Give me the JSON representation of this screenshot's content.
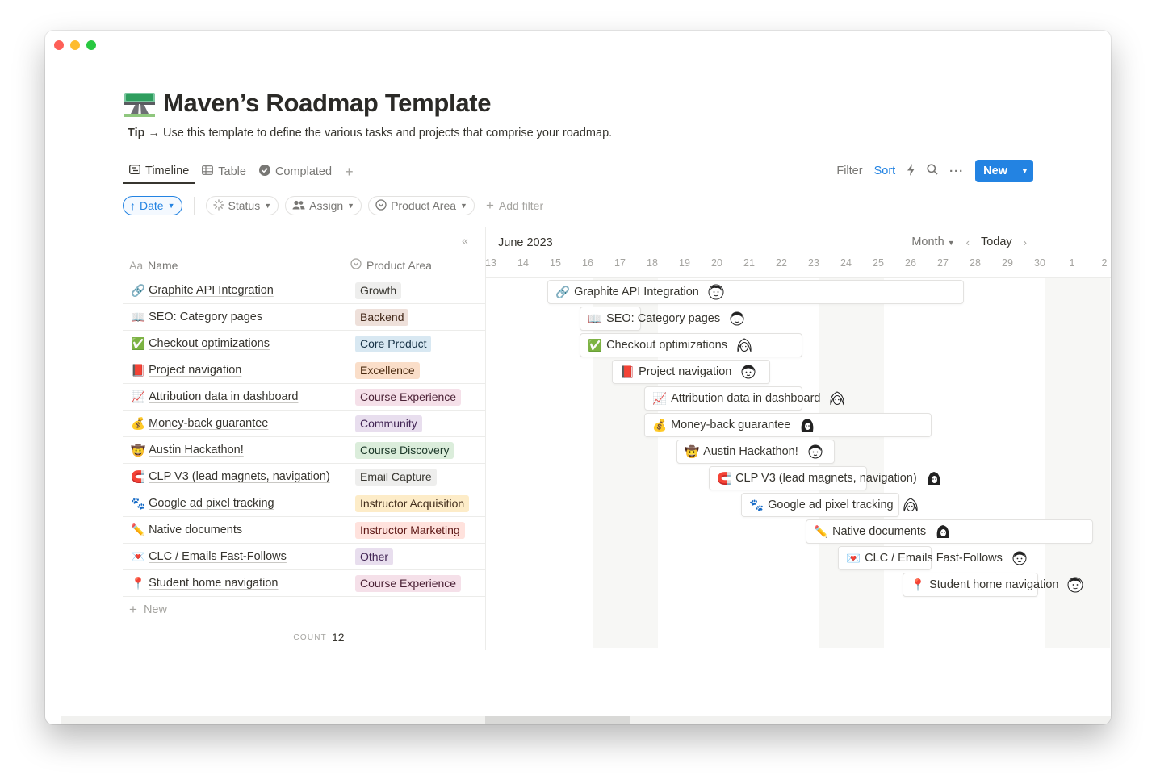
{
  "page": {
    "title": "Maven’s Roadmap Template",
    "tip_label": "Tip",
    "tip_arrow": "→",
    "tip_text": "Use this template to define the various tasks and projects that comprise your roadmap."
  },
  "tabs": [
    {
      "label": "Timeline",
      "icon": "timeline-icon",
      "active": true
    },
    {
      "label": "Table",
      "icon": "table-icon"
    },
    {
      "label": "Compl­ated",
      "icon": "check-circle-icon"
    }
  ],
  "toolbar": {
    "filter_label": "Filter",
    "sort_label": "Sort",
    "new_label": "New"
  },
  "filters": {
    "date": "Date",
    "status": "Status",
    "assign": "Assign",
    "product_area": "Product Area",
    "add_filter": "Add filter"
  },
  "table": {
    "name_header": "Name",
    "name_header_prefix": "Aa",
    "area_header": "Product Area",
    "new_row": "New",
    "count_label": "COUNT",
    "count_value": "12",
    "rows": [
      {
        "emoji": "🔗",
        "name": "Graphite API Integration",
        "area": "Growth",
        "area_bg": "#eeeeed",
        "area_fg": "#37352f"
      },
      {
        "emoji": "📖",
        "name": "SEO: Category pages",
        "area": "Backend",
        "area_bg": "#eee0da",
        "area_fg": "#44291a"
      },
      {
        "emoji": "✅",
        "name": "Checkout optimizations",
        "area": "Core Product",
        "area_bg": "#d8e8f2",
        "area_fg": "#183347"
      },
      {
        "emoji": "📕",
        "name": "Project navigation",
        "area": "Excellence",
        "area_bg": "#fadec9",
        "area_fg": "#49290e"
      },
      {
        "emoji": "📈",
        "name": "Attribution data in dashboard",
        "area": "Course Experience",
        "area_bg": "#f5e0e9",
        "area_fg": "#4c2337"
      },
      {
        "emoji": "💰",
        "name": "Money-back guarantee",
        "area": "Community",
        "area_bg": "#e8deee",
        "area_fg": "#412454"
      },
      {
        "emoji": "🤠",
        "name": "Austin Hackathon!",
        "area": "Course Discovery",
        "area_bg": "#dbeddb",
        "area_fg": "#1c3829"
      },
      {
        "emoji": "🧲",
        "name": "CLP V3 (lead magnets, navigation)",
        "area": "Email Capture",
        "area_bg": "#eeeeed",
        "area_fg": "#37352f"
      },
      {
        "emoji": "🐾",
        "name": "Google ad pixel tracking",
        "area": "Instructor Acquisition",
        "area_bg": "#fdecc8",
        "area_fg": "#402c1b"
      },
      {
        "emoji": "✏️",
        "name": "Native documents",
        "area": "Instructor Marketing",
        "area_bg": "#ffe2dd",
        "area_fg": "#5d1715"
      },
      {
        "emoji": "💌",
        "name": "CLC / Emails Fast-Follows",
        "area": "Other",
        "area_bg": "#e8deee",
        "area_fg": "#412454"
      },
      {
        "emoji": "📍",
        "name": "Student home navigation",
        "area": "Course Experience",
        "area_bg": "#f5e0e9",
        "area_fg": "#4c2337"
      }
    ]
  },
  "timeline": {
    "month": "June 2023",
    "scale": "Month",
    "today": "Today",
    "days": [
      "13",
      "14",
      "15",
      "16",
      "17",
      "18",
      "19",
      "20",
      "21",
      "22",
      "23",
      "24",
      "25",
      "26",
      "27",
      "28",
      "29",
      "30",
      "1",
      "2"
    ],
    "weekend_cols": [
      [
        3,
        5
      ],
      [
        10,
        12
      ],
      [
        17,
        19
      ]
    ],
    "bars": [
      {
        "start": 1.75,
        "end": 14.65,
        "row": 0
      },
      {
        "start": 2.75,
        "end": 4.65,
        "row": 1
      },
      {
        "start": 2.75,
        "end": 9.65,
        "row": 2
      },
      {
        "start": 3.75,
        "end": 8.65,
        "row": 3
      },
      {
        "start": 4.75,
        "end": 9.65,
        "row": 4
      },
      {
        "start": 4.75,
        "end": 13.65,
        "row": 5
      },
      {
        "start": 5.75,
        "end": 10.65,
        "row": 6
      },
      {
        "start": 6.75,
        "end": 11.65,
        "row": 7
      },
      {
        "start": 7.75,
        "end": 12.65,
        "row": 8
      },
      {
        "start": 9.75,
        "end": 18.65,
        "row": 9
      },
      {
        "start": 10.75,
        "end": 13.65,
        "row": 10
      },
      {
        "start": 12.75,
        "end": 16.95,
        "row": 11
      }
    ],
    "avatars": [
      "face-a",
      "face-b",
      "face-c",
      "face-b",
      "face-c",
      "face-d",
      "face-b",
      "face-d",
      "face-c",
      "face-d",
      "face-b",
      "face-a"
    ]
  }
}
